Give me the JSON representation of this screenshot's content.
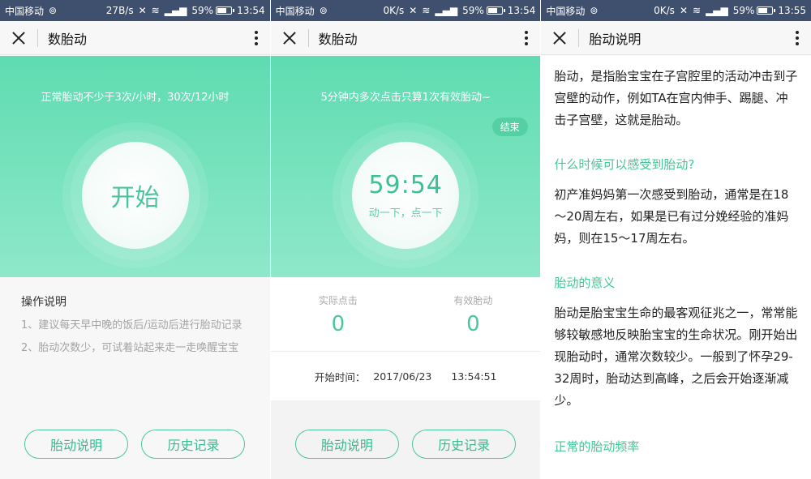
{
  "screens": [
    {
      "status": {
        "carrier": "中国移动",
        "speed": "27B/s",
        "battery": "59%",
        "time": "13:54",
        "network": "4G"
      },
      "appbar": {
        "title": "数胎动"
      },
      "hero": {
        "tip": "正常胎动不少于3次/小时，30次/12小时",
        "button": "开始"
      },
      "instructions": {
        "heading": "操作说明",
        "items": [
          "1、建议每天早中晚的饭后/运动后进行胎动记录",
          "2、胎动次数少，可试着站起来走一走唤醒宝宝"
        ]
      },
      "buttons": {
        "explain": "胎动说明",
        "history": "历史记录"
      }
    },
    {
      "status": {
        "carrier": "中国移动",
        "speed": "0K/s",
        "battery": "59%",
        "time": "13:54",
        "network": "4G"
      },
      "appbar": {
        "title": "数胎动"
      },
      "hero": {
        "tip": "5分钟内多次点击只算1次有效胎动~",
        "end": "结束",
        "timer": "59:54",
        "sub": "动一下，点一下"
      },
      "stats": {
        "clicks_label": "实际点击",
        "clicks": "0",
        "valid_label": "有效胎动",
        "valid": "0"
      },
      "start_time": {
        "label": "开始时间：",
        "date": "2017/06/23",
        "time": "13:54:51"
      },
      "buttons": {
        "explain": "胎动说明",
        "history": "历史记录"
      }
    },
    {
      "status": {
        "carrier": "中国移动",
        "speed": "0K/s",
        "battery": "59%",
        "time": "13:55",
        "network": "4G"
      },
      "appbar": {
        "title": "胎动说明"
      },
      "article": {
        "intro": "胎动，是指胎宝宝在子宫腔里的活动冲击到子宫壁的动作，例如TA在宫内伸手、踢腿、冲击子宫壁，这就是胎动。",
        "q1": "什么时候可以感受到胎动?",
        "a1": "初产准妈妈第一次感受到胎动，通常是在18～20周左右，如果是已有过分娩经验的准妈妈，则在15～17周左右。",
        "q2": "胎动的意义",
        "a2": "胎动是胎宝宝生命的最客观征兆之一，常常能够较敏感地反映胎宝宝的生命状况。刚开始出现胎动时，通常次数较少。一般到了怀孕29-32周时，胎动达到高峰，之后会开始逐渐减少。",
        "q3": "正常的胎动频率"
      }
    }
  ],
  "colors": {
    "accent": "#4bc79c",
    "status_bar": "#3f4f6e",
    "hero_top": "#5fdcb1",
    "hero_bottom": "#8ee8c9"
  }
}
